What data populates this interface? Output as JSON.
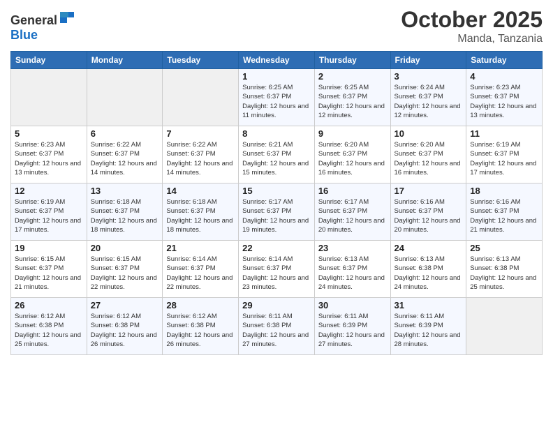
{
  "header": {
    "logo_general": "General",
    "logo_blue": "Blue",
    "month": "October 2025",
    "location": "Manda, Tanzania"
  },
  "weekdays": [
    "Sunday",
    "Monday",
    "Tuesday",
    "Wednesday",
    "Thursday",
    "Friday",
    "Saturday"
  ],
  "weeks": [
    [
      {
        "day": "",
        "sunrise": "",
        "sunset": "",
        "daylight": ""
      },
      {
        "day": "",
        "sunrise": "",
        "sunset": "",
        "daylight": ""
      },
      {
        "day": "",
        "sunrise": "",
        "sunset": "",
        "daylight": ""
      },
      {
        "day": "1",
        "sunrise": "Sunrise: 6:25 AM",
        "sunset": "Sunset: 6:37 PM",
        "daylight": "Daylight: 12 hours and 11 minutes."
      },
      {
        "day": "2",
        "sunrise": "Sunrise: 6:25 AM",
        "sunset": "Sunset: 6:37 PM",
        "daylight": "Daylight: 12 hours and 12 minutes."
      },
      {
        "day": "3",
        "sunrise": "Sunrise: 6:24 AM",
        "sunset": "Sunset: 6:37 PM",
        "daylight": "Daylight: 12 hours and 12 minutes."
      },
      {
        "day": "4",
        "sunrise": "Sunrise: 6:23 AM",
        "sunset": "Sunset: 6:37 PM",
        "daylight": "Daylight: 12 hours and 13 minutes."
      }
    ],
    [
      {
        "day": "5",
        "sunrise": "Sunrise: 6:23 AM",
        "sunset": "Sunset: 6:37 PM",
        "daylight": "Daylight: 12 hours and 13 minutes."
      },
      {
        "day": "6",
        "sunrise": "Sunrise: 6:22 AM",
        "sunset": "Sunset: 6:37 PM",
        "daylight": "Daylight: 12 hours and 14 minutes."
      },
      {
        "day": "7",
        "sunrise": "Sunrise: 6:22 AM",
        "sunset": "Sunset: 6:37 PM",
        "daylight": "Daylight: 12 hours and 14 minutes."
      },
      {
        "day": "8",
        "sunrise": "Sunrise: 6:21 AM",
        "sunset": "Sunset: 6:37 PM",
        "daylight": "Daylight: 12 hours and 15 minutes."
      },
      {
        "day": "9",
        "sunrise": "Sunrise: 6:20 AM",
        "sunset": "Sunset: 6:37 PM",
        "daylight": "Daylight: 12 hours and 16 minutes."
      },
      {
        "day": "10",
        "sunrise": "Sunrise: 6:20 AM",
        "sunset": "Sunset: 6:37 PM",
        "daylight": "Daylight: 12 hours and 16 minutes."
      },
      {
        "day": "11",
        "sunrise": "Sunrise: 6:19 AM",
        "sunset": "Sunset: 6:37 PM",
        "daylight": "Daylight: 12 hours and 17 minutes."
      }
    ],
    [
      {
        "day": "12",
        "sunrise": "Sunrise: 6:19 AM",
        "sunset": "Sunset: 6:37 PM",
        "daylight": "Daylight: 12 hours and 17 minutes."
      },
      {
        "day": "13",
        "sunrise": "Sunrise: 6:18 AM",
        "sunset": "Sunset: 6:37 PM",
        "daylight": "Daylight: 12 hours and 18 minutes."
      },
      {
        "day": "14",
        "sunrise": "Sunrise: 6:18 AM",
        "sunset": "Sunset: 6:37 PM",
        "daylight": "Daylight: 12 hours and 18 minutes."
      },
      {
        "day": "15",
        "sunrise": "Sunrise: 6:17 AM",
        "sunset": "Sunset: 6:37 PM",
        "daylight": "Daylight: 12 hours and 19 minutes."
      },
      {
        "day": "16",
        "sunrise": "Sunrise: 6:17 AM",
        "sunset": "Sunset: 6:37 PM",
        "daylight": "Daylight: 12 hours and 20 minutes."
      },
      {
        "day": "17",
        "sunrise": "Sunrise: 6:16 AM",
        "sunset": "Sunset: 6:37 PM",
        "daylight": "Daylight: 12 hours and 20 minutes."
      },
      {
        "day": "18",
        "sunrise": "Sunrise: 6:16 AM",
        "sunset": "Sunset: 6:37 PM",
        "daylight": "Daylight: 12 hours and 21 minutes."
      }
    ],
    [
      {
        "day": "19",
        "sunrise": "Sunrise: 6:15 AM",
        "sunset": "Sunset: 6:37 PM",
        "daylight": "Daylight: 12 hours and 21 minutes."
      },
      {
        "day": "20",
        "sunrise": "Sunrise: 6:15 AM",
        "sunset": "Sunset: 6:37 PM",
        "daylight": "Daylight: 12 hours and 22 minutes."
      },
      {
        "day": "21",
        "sunrise": "Sunrise: 6:14 AM",
        "sunset": "Sunset: 6:37 PM",
        "daylight": "Daylight: 12 hours and 22 minutes."
      },
      {
        "day": "22",
        "sunrise": "Sunrise: 6:14 AM",
        "sunset": "Sunset: 6:37 PM",
        "daylight": "Daylight: 12 hours and 23 minutes."
      },
      {
        "day": "23",
        "sunrise": "Sunrise: 6:13 AM",
        "sunset": "Sunset: 6:37 PM",
        "daylight": "Daylight: 12 hours and 24 minutes."
      },
      {
        "day": "24",
        "sunrise": "Sunrise: 6:13 AM",
        "sunset": "Sunset: 6:38 PM",
        "daylight": "Daylight: 12 hours and 24 minutes."
      },
      {
        "day": "25",
        "sunrise": "Sunrise: 6:13 AM",
        "sunset": "Sunset: 6:38 PM",
        "daylight": "Daylight: 12 hours and 25 minutes."
      }
    ],
    [
      {
        "day": "26",
        "sunrise": "Sunrise: 6:12 AM",
        "sunset": "Sunset: 6:38 PM",
        "daylight": "Daylight: 12 hours and 25 minutes."
      },
      {
        "day": "27",
        "sunrise": "Sunrise: 6:12 AM",
        "sunset": "Sunset: 6:38 PM",
        "daylight": "Daylight: 12 hours and 26 minutes."
      },
      {
        "day": "28",
        "sunrise": "Sunrise: 6:12 AM",
        "sunset": "Sunset: 6:38 PM",
        "daylight": "Daylight: 12 hours and 26 minutes."
      },
      {
        "day": "29",
        "sunrise": "Sunrise: 6:11 AM",
        "sunset": "Sunset: 6:38 PM",
        "daylight": "Daylight: 12 hours and 27 minutes."
      },
      {
        "day": "30",
        "sunrise": "Sunrise: 6:11 AM",
        "sunset": "Sunset: 6:39 PM",
        "daylight": "Daylight: 12 hours and 27 minutes."
      },
      {
        "day": "31",
        "sunrise": "Sunrise: 6:11 AM",
        "sunset": "Sunset: 6:39 PM",
        "daylight": "Daylight: 12 hours and 28 minutes."
      },
      {
        "day": "",
        "sunrise": "",
        "sunset": "",
        "daylight": ""
      }
    ]
  ]
}
